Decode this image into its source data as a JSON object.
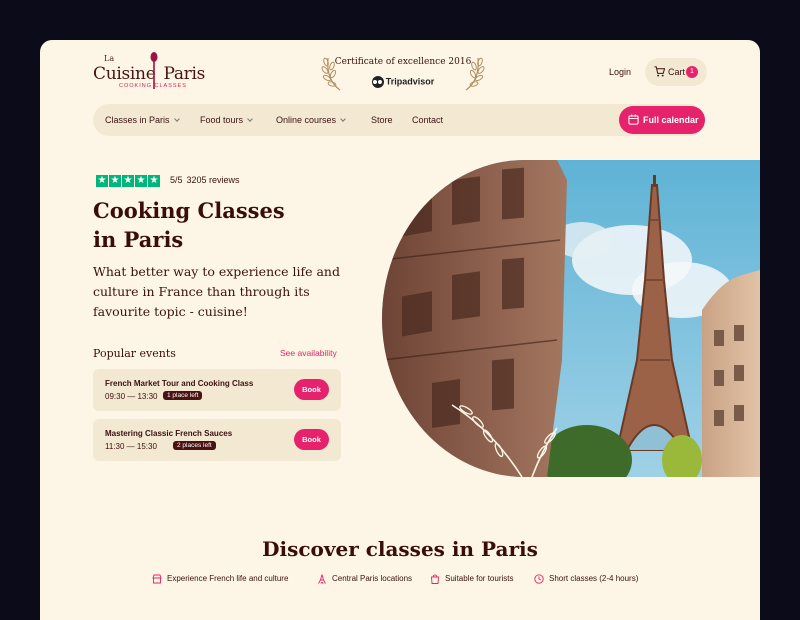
{
  "logo": {
    "la": "La",
    "main_left": "Cuisine",
    "main_right": "Paris",
    "sub": "COOKING CLASSES"
  },
  "certificate": {
    "title": "Certificate of excellence 2016",
    "brand": "Tripadvisor"
  },
  "header": {
    "login": "Login",
    "cart_label": "Cart",
    "cart_count": "1"
  },
  "nav": {
    "items": [
      {
        "label": "Classes in Paris",
        "dropdown": true
      },
      {
        "label": "Food tours",
        "dropdown": true
      },
      {
        "label": "Online courses",
        "dropdown": true
      },
      {
        "label": "Store",
        "dropdown": false
      },
      {
        "label": "Contact",
        "dropdown": false
      }
    ],
    "calendar_button": "Full calendar"
  },
  "hero": {
    "rating": "5/5",
    "reviews": "3205 reviews",
    "title_line1": "Cooking Classes",
    "title_line2": "in Paris",
    "lead": "What better way to experience life and culture in France than through its favourite topic - cuisine!",
    "popular_title": "Popular events",
    "see_availability": "See availability",
    "events": [
      {
        "name": "French Market Tour and Cooking Class",
        "time": "09:30 — 13:30",
        "availability": "1 place left",
        "book": "Book"
      },
      {
        "name": "Mastering Classic French Sauces",
        "time": "11:30 — 15:30",
        "availability": "2 places left",
        "book": "Book"
      }
    ]
  },
  "discover": {
    "title": "Discover classes in Paris",
    "features": [
      {
        "icon": "market-icon",
        "label": "Experience French life and culture"
      },
      {
        "icon": "eiffel-tower-icon",
        "label": "Central Paris locations"
      },
      {
        "icon": "shopping-bag-icon",
        "label": "Suitable for tourists"
      },
      {
        "icon": "clock-icon",
        "label": "Short classes (2-4 hours)"
      }
    ]
  },
  "colors": {
    "accent": "#e5226b",
    "text": "#3a0d0d",
    "background": "#fdf6e6",
    "panel": "#f3e9d2",
    "trustpilot": "#00b67a"
  }
}
